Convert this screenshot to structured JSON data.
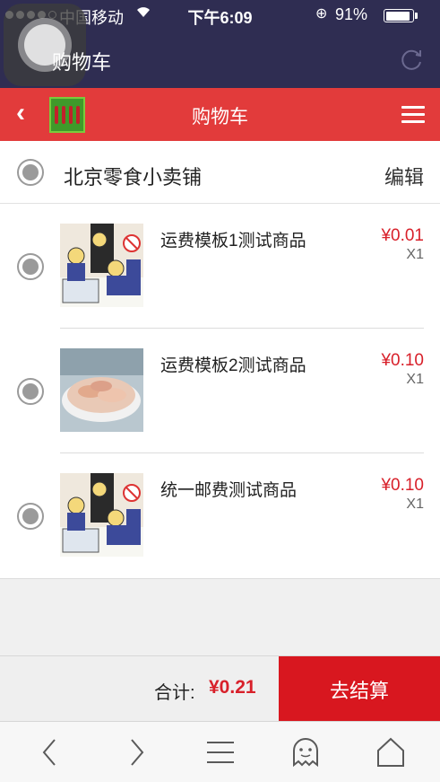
{
  "status_bar": {
    "carrier": "中国移动",
    "time": "下午6:09",
    "battery_percent": "91%",
    "battery_level": 0.91,
    "icons": [
      "signal-dots",
      "wifi-icon",
      "rotation-lock-icon",
      "battery-icon"
    ]
  },
  "app_header": {
    "title": "购物车",
    "icons": [
      "assistive-touch",
      "refresh-icon"
    ]
  },
  "nav": {
    "title": "购物车",
    "icons": [
      "back-icon",
      "shop-logo",
      "menu-icon"
    ]
  },
  "shop": {
    "name": "北京零食小卖铺",
    "edit_label": "编辑"
  },
  "items": [
    {
      "title": "运费模板1测试商品",
      "price": "¥0.01",
      "qty": "X1",
      "image": "cartoon-police-image"
    },
    {
      "title": "运费模板2测试商品",
      "price": "¥0.10",
      "qty": "X1",
      "image": "dried-shrimp-image"
    },
    {
      "title": "统一邮费测试商品",
      "price": "¥0.10",
      "qty": "X1",
      "image": "cartoon-police-image"
    }
  ],
  "checkout": {
    "total_label": "合计:",
    "total_value": "¥0.21",
    "button_label": "去结算"
  },
  "toolbar": {
    "icons": [
      "back-arrow-icon",
      "forward-arrow-icon",
      "menu-lines-icon",
      "ghost-icon",
      "home-icon"
    ]
  },
  "colors": {
    "status_bg": "#2f2d52",
    "nav_red": "#e23b3b",
    "price_red": "#d8202a",
    "checkout_red": "#d8171f",
    "radio_gray": "#9a9a9a"
  }
}
